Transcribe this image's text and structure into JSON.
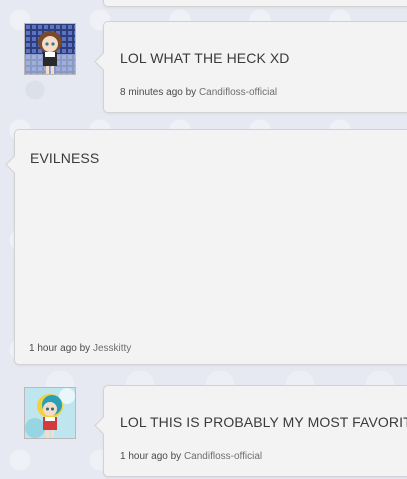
{
  "comments": [
    {
      "message": "LOL WHAT THE HECK XD",
      "time": "8 minutes ago",
      "by": "by",
      "author": "Candifloss-official",
      "avatar_icon": "user-avatar-anime-girl-icon"
    },
    {
      "message": "EVILNESS",
      "time": "1 hour ago",
      "by": "by",
      "author": "Jesskitty",
      "avatar_icon": ""
    },
    {
      "message": "LOL THIS IS PROBABLY MY MOST FAVORIT",
      "time": "1 hour ago",
      "by": "by",
      "author": "Candifloss-official",
      "avatar_icon": "user-avatar-anime-girl-icon"
    }
  ],
  "colors": {
    "page_background": "#e6e9f1",
    "card_background": "#f3f3f3",
    "card_border": "#d2d2d2",
    "text": "#3a3a3a",
    "author_link": "#6e6e6e"
  }
}
